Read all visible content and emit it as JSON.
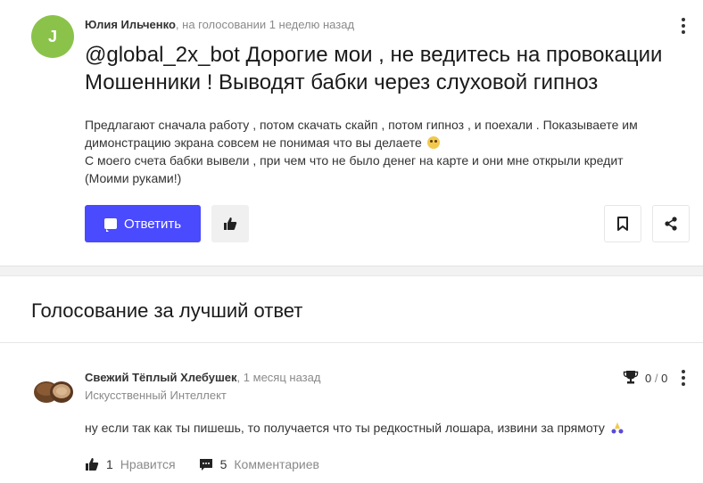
{
  "question": {
    "avatar_letter": "J",
    "author": "Юлия Ильченко",
    "separator": ",",
    "status_time": "на голосовании 1 неделю назад",
    "title_line1": "@global_2x_bot Дорогие мои , не ведитесь на провокации",
    "title_line2": "Мошенники ! Выводят бабки через слуховой гипноз",
    "body_line1": "Предлагают сначала работу , потом скачать скайп , потом гипноз , и поехали . Показываете им",
    "body_line2": "димонстрацию экрана совсем не понимая что вы делаете",
    "body_line3": "С моего счета бабки вывели , при чем что не было денег на карте и они мне открыли кредит",
    "body_line4": "(Моими руками!)",
    "answer_label": "Ответить"
  },
  "vote_section": {
    "title": "Голосование за лучший ответ"
  },
  "answer": {
    "author": "Свежий Тёплый Хлебушек",
    "separator": ",",
    "time": "1 месяц назад",
    "category": "Искусственный Интеллект",
    "score_a": "0",
    "score_slash": "/",
    "score_b": "0",
    "text": "ну если так как ты пишешь, то получается что ты редкостный лошара, извини за прямоту",
    "likes_count": "1",
    "likes_label": "Нравится",
    "comments_count": "5",
    "comments_label": "Комментариев"
  },
  "colors": {
    "accent": "#4a4aff",
    "avatar_bg": "#8bc34a",
    "muted_text": "#8a8a8a"
  },
  "icons": [
    "chat-icon",
    "thumbs-up-icon",
    "bookmark-icon",
    "share-icon",
    "more-vertical-icon",
    "trophy-icon",
    "comments-icon"
  ]
}
